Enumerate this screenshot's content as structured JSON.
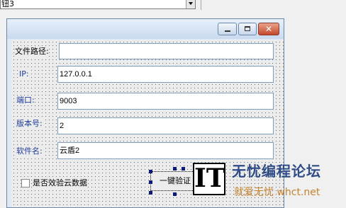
{
  "top_combo": {
    "value": "钮3"
  },
  "form": {
    "file_path": {
      "label": "文件路径:",
      "value": ""
    },
    "ip": {
      "label": "IP:",
      "value": "127.0.0.1"
    },
    "port": {
      "label": "端口:",
      "value": "9003"
    },
    "version": {
      "label": "版本号:",
      "value": "2"
    },
    "software": {
      "label": "软件名:",
      "value": "云盾2"
    },
    "cloud_check": {
      "label": "是否效验云数据",
      "checked": false
    },
    "verify_button": {
      "label": "一键验证"
    }
  },
  "window_buttons": {
    "close_glyph": "✕"
  },
  "selection_glyph": "IT",
  "watermark": {
    "title": "无忧编程论坛",
    "subtitle": "就爱无忧 whct.net"
  }
}
